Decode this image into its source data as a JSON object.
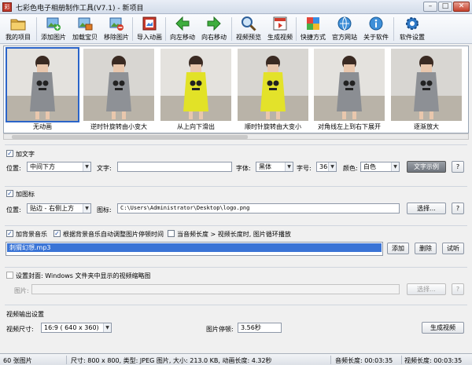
{
  "window": {
    "title": "七彩色电子相册制作工具(V7.1) - 新项目",
    "controls": {
      "minimize": "–",
      "maximize": "□",
      "close": "✕"
    }
  },
  "toolbar": {
    "items": [
      {
        "label": "我的项目",
        "icon": "folder-icon"
      },
      {
        "label": "添加图片",
        "icon": "add-image-icon"
      },
      {
        "label": "加载宝贝",
        "icon": "load-item-icon"
      },
      {
        "label": "移除图片",
        "icon": "remove-image-icon"
      },
      {
        "label": "导入动画",
        "icon": "import-animation-icon"
      },
      {
        "label": "向左移动",
        "icon": "arrow-left-icon"
      },
      {
        "label": "向右移动",
        "icon": "arrow-right-icon"
      },
      {
        "label": "视频预览",
        "icon": "magnifier-icon"
      },
      {
        "label": "生成视频",
        "icon": "video-generate-icon"
      },
      {
        "label": "快捷方式",
        "icon": "shortcut-cubes-icon"
      },
      {
        "label": "官方网站",
        "icon": "globe-icon"
      },
      {
        "label": "关于软件",
        "icon": "info-icon"
      },
      {
        "label": "软件设置",
        "icon": "gear-icon"
      }
    ]
  },
  "thumbnails": [
    {
      "caption": "无动画",
      "dress": "#8a8d92"
    },
    {
      "caption": "逆时针旋转由小变大",
      "dress": "#8e9196"
    },
    {
      "caption": "从上向下滑出",
      "dress": "#e2e227"
    },
    {
      "caption": "顺时针旋转由大变小",
      "dress": "#e3e22a"
    },
    {
      "caption": "对角线左上到右下展开",
      "dress": "#8b8e93"
    },
    {
      "caption": "逐渐放大",
      "dress": "#8d9095"
    }
  ],
  "text_section": {
    "checkbox_label": "加文字",
    "position_label": "位置:",
    "position_value": "中间下方",
    "text_label": "文字:",
    "text_value": "",
    "font_label": "字体:",
    "font_value": "黑体",
    "size_label": "字号:",
    "size_value": "36",
    "color_label": "颜色:",
    "color_value": "白色",
    "sample_button": "文字示例",
    "help_button": "?"
  },
  "icon_section": {
    "checkbox_label": "加图标",
    "position_label": "位置:",
    "position_value": "贴边 - 右侧上方",
    "icon_label": "图标:",
    "icon_path": "C:\\Users\\Administrator\\Desktop\\logo.png",
    "browse_button": "选择...",
    "help_button": "?"
  },
  "music_section": {
    "add_music_label": "加背景音乐",
    "auto_adjust_label": "根据背景音乐自动调整图片停顿时间",
    "loop_label": "当音频长度 > 视频长度时, 图片循环播放",
    "music_file": "刺猬幻想.mp3",
    "add_button": "添加",
    "delete_button": "删除",
    "listen_button": "试听"
  },
  "cover_section": {
    "checkbox_label": "设置封面: Windows 文件夹中显示的视频缩略图",
    "image_label": "图片:",
    "image_value": "",
    "browse_button": "选择...",
    "help_button": "?"
  },
  "output_section": {
    "heading": "视频输出设置",
    "size_label": "视频尺寸:",
    "size_value": "16:9 ( 640 x 360)",
    "pause_label": "图片停顿:",
    "pause_value": "3.56秒",
    "generate_button": "生成视频"
  },
  "statusbar": {
    "count": "60 张图片",
    "info": "尺寸: 800 x 800, 类型: JPEG 图片, 大小: 213.0 KB, 动画长度: 4.32秒",
    "audio_length": "音频长度: 00:03:35",
    "video_length": "视频长度: 00:03:35"
  },
  "colors": {
    "accent": "#2b64c9",
    "selection": "#3a74d6"
  }
}
